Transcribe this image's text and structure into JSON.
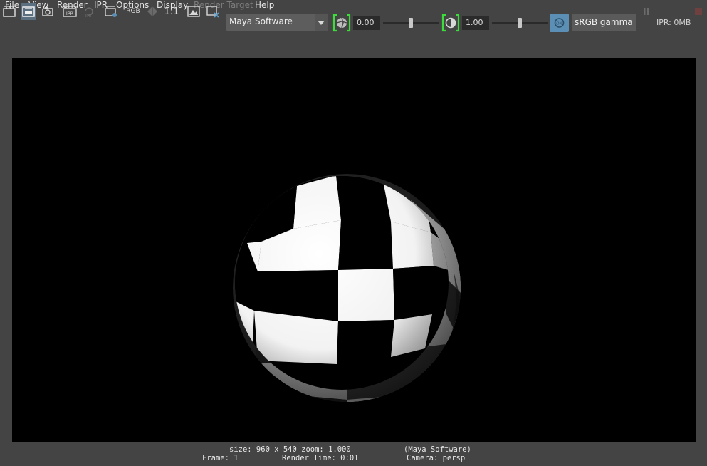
{
  "menus": [
    "File",
    "View",
    "Render",
    "IPR",
    "Options",
    "Display",
    "Render Target",
    "Help"
  ],
  "menus_disabled": [
    "Render Target"
  ],
  "toolbar": {
    "rgb_label": "RGB",
    "ratio_label": "1:1",
    "renderer": "Maya Software",
    "exposure_value": "0.00",
    "exposure_slider_fraction": 0.5,
    "gamma_value": "1.00",
    "gamma_slider_fraction": 0.5,
    "color_management_toggle": "ON",
    "view_transform": "sRGB gamma",
    "ipr_memory": "IPR: 0MB"
  },
  "icons": [
    "render-frame-icon",
    "redo-render-icon",
    "snapshot-icon",
    "ipr-render-icon",
    "ipr-refresh-icon",
    "render-region-icon",
    "rgb-channels-icon",
    "alpha-channel-icon",
    "real-size-icon",
    "keep-image-icon",
    "remove-image-icon",
    "exposure-icon",
    "gamma-icon",
    "color-management-icon",
    "ipr-pause-icon",
    "stop-render-icon"
  ],
  "status": {
    "size_zoom": "size: 960 x 540 zoom: 1.000",
    "renderer": "(Maya Software)",
    "frame": "Frame: 1",
    "render_time": "Render Time: 0:01",
    "camera": "Camera: persp"
  },
  "colors": {
    "panel_bg": "#444444",
    "viewport_bg": "#000000",
    "accent_green": "#3ddc3d",
    "toggle_blue": "#5b8fb5"
  }
}
